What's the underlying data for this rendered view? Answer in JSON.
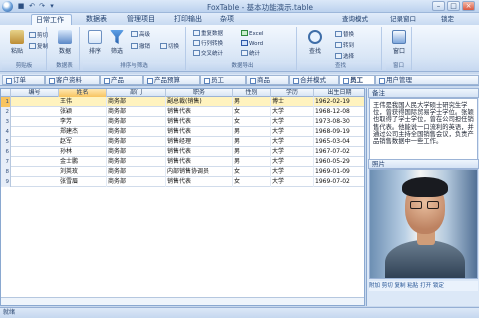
{
  "window": {
    "title": "FoxTable - 基本功能演示.table",
    "minimize": "–",
    "maximize": "□",
    "close": "×"
  },
  "quick_access": {
    "save": "■",
    "undo": "↶",
    "redo": "↷",
    "more": "▾"
  },
  "ribbon_tabs": [
    "日常工作",
    "数据表",
    "管理项目",
    "打印输出",
    "杂项"
  ],
  "right_menu": [
    "查询模式",
    "记录窗口",
    "锁定"
  ],
  "ribbon": {
    "groups": [
      {
        "name": "剪贴板",
        "buttons": [
          "粘贴",
          "剪切",
          "复制"
        ]
      },
      {
        "name": "数据表",
        "buttons": [
          "数据"
        ]
      },
      {
        "name": "排序与筛选",
        "buttons": [
          "排序",
          "筛选",
          "高级",
          "撤销",
          "切换"
        ]
      },
      {
        "name": "数据导出",
        "buttons": [
          "重复数据",
          "行列转换",
          "交叉统计",
          "Excel",
          "Word",
          "统计"
        ]
      },
      {
        "name": "查找",
        "buttons": [
          "查找",
          "替换",
          "转到",
          "选择"
        ]
      },
      {
        "name": "窗口",
        "buttons": [
          "窗口"
        ]
      }
    ]
  },
  "document_tabs": [
    "订单",
    "客户资料",
    "产品",
    "产品预算",
    "员工",
    "商品",
    "合并模式",
    "员工",
    "用户管理"
  ],
  "grid": {
    "columns": [
      "编号",
      "姓名",
      "部门",
      "职务",
      "性别",
      "学历",
      "出生日期"
    ],
    "rows": [
      [
        "1",
        "王伟",
        "商务部",
        "副总裁(销售)",
        "男",
        "博士",
        "1962-02-19"
      ],
      [
        "2",
        "张颖",
        "商务部",
        "销售代表",
        "女",
        "大学",
        "1968-12-08"
      ],
      [
        "3",
        "李芳",
        "商务部",
        "销售代表",
        "女",
        "大学",
        "1973-08-30"
      ],
      [
        "4",
        "郑建杰",
        "商务部",
        "销售代表",
        "男",
        "大学",
        "1968-09-19"
      ],
      [
        "5",
        "赵军",
        "商务部",
        "销售经理",
        "男",
        "大学",
        "1965-03-04"
      ],
      [
        "6",
        "孙林",
        "商务部",
        "销售代表",
        "男",
        "大学",
        "1967-07-02"
      ],
      [
        "7",
        "金士鹏",
        "商务部",
        "销售代表",
        "男",
        "大学",
        "1960-05-29"
      ],
      [
        "8",
        "刘英玫",
        "商务部",
        "内部销售协调员",
        "女",
        "大学",
        "1969-01-09"
      ],
      [
        "9",
        "张雪眉",
        "商务部",
        "销售代表",
        "女",
        "大学",
        "1969-07-02"
      ]
    ]
  },
  "side_panel": {
    "memo_title": "备注",
    "memo_text": "王伟是我国人民大学硕士研究生学位，曾获得国际贸易学士学位。张颖也取得了学士学位，曾在公司担任销售代表。他能说一口流利的英语，并通过公司主持全国销售会议，负责产品销售数据中一些工作。",
    "photo_title": "照片",
    "photo_toolbar": [
      "附加",
      "剪切",
      "复制",
      "粘贴",
      "打开",
      "锁定"
    ]
  },
  "status": {
    "text": "就绪"
  }
}
